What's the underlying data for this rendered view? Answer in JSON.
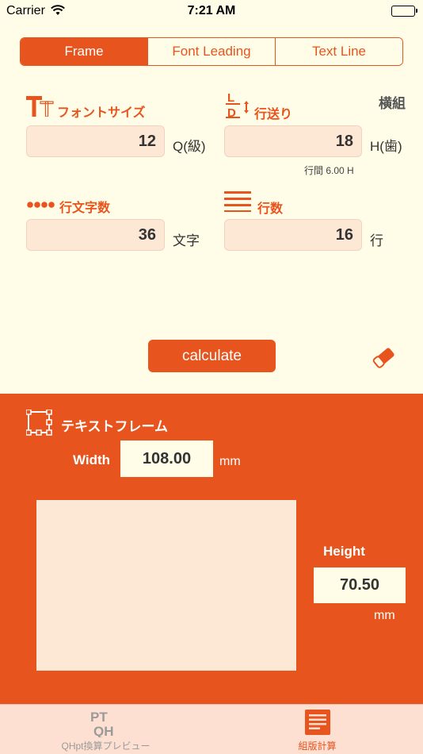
{
  "status_bar": {
    "carrier": "Carrier",
    "time": "7:21 AM"
  },
  "segments": [
    {
      "label": "Frame",
      "active": true
    },
    {
      "label": "Font Leading",
      "active": false
    },
    {
      "label": "Text Line",
      "active": false
    }
  ],
  "orientation": "横組",
  "font_size": {
    "label": "フォントサイズ",
    "value": "12",
    "unit": "Q(級)"
  },
  "leading": {
    "label": "行送り",
    "value": "18",
    "unit": "H(歯)",
    "note": "行間 6.00 H"
  },
  "chars_per_line": {
    "label": "行文字数",
    "value": "36",
    "unit": "文字"
  },
  "line_count": {
    "label": "行数",
    "value": "16",
    "unit": "行"
  },
  "calculate_label": "calculate",
  "result": {
    "title": "テキストフレーム",
    "width_label": "Width",
    "width_value": "108.00",
    "width_unit": "mm",
    "height_label": "Height",
    "height_value": "70.50",
    "height_unit": "mm"
  },
  "tabs": [
    {
      "label": "QHpt換算プレビュー",
      "active": false
    },
    {
      "label": "組版計算",
      "active": true
    }
  ],
  "colors": {
    "accent": "#e8541e",
    "background": "#fffde7",
    "field": "#fde8d6"
  }
}
